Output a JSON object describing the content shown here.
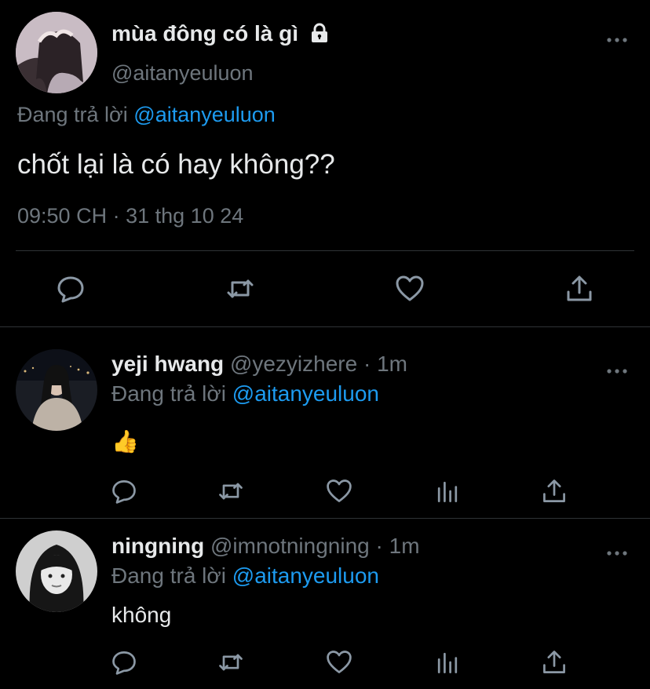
{
  "main_tweet": {
    "display_name": "mùa đông có là gì",
    "handle": "@aitanyeuluon",
    "replying_prefix": "Đang trả lời",
    "replying_to": "@aitanyeuluon",
    "text": "chốt lại là có hay không??",
    "time": "09:50 CH",
    "separator": "·",
    "date": "31 thg 10 24",
    "icons": [
      "lock-icon",
      "more-icon",
      "reply-icon",
      "retweet-icon",
      "like-icon",
      "share-icon"
    ]
  },
  "replies": [
    {
      "display_name": "yeji hwang",
      "handle": "@yezyizhere",
      "time": "· 1m",
      "replying_prefix": "Đang trả lời",
      "replying_to": "@aitanyeuluon",
      "text": "👍"
    },
    {
      "display_name": "ningning",
      "handle": "@imnotningning",
      "time": "· 1m",
      "replying_prefix": "Đang trả lời",
      "replying_to": "@aitanyeuluon",
      "text": "không"
    }
  ],
  "colors": {
    "background": "#000000",
    "text": "#e7e9ea",
    "muted": "#6e767d",
    "link": "#1d9bf0",
    "divider": "#2f3336"
  }
}
